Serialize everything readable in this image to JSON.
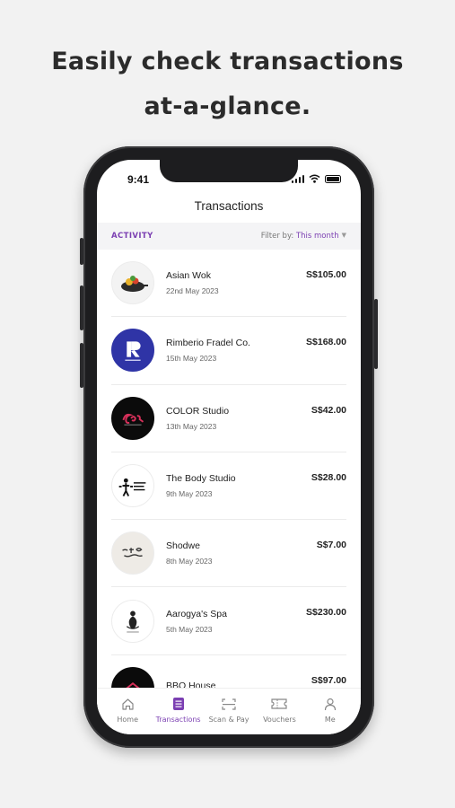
{
  "headline": {
    "line1": "Easily check transactions",
    "line2": "at-a-glance."
  },
  "status_bar": {
    "time": "9:41"
  },
  "header": {
    "title": "Transactions"
  },
  "filter_bar": {
    "activity_label": "ACTIVITY",
    "filter_prefix": "Filter by:",
    "filter_value": "This month"
  },
  "transactions": [
    {
      "name": "Asian Wok",
      "date": "22nd May 2023",
      "amount": "S$105.00",
      "logo": "asian-wok-logo"
    },
    {
      "name": "Rimberio Fradel Co.",
      "date": "15th May 2023",
      "amount": "S$168.00",
      "logo": "rimberio-logo"
    },
    {
      "name": "COLOR Studio",
      "date": "13th May 2023",
      "amount": "S$42.00",
      "logo": "color-studio-logo"
    },
    {
      "name": "The Body Studio",
      "date": "9th May 2023",
      "amount": "S$28.00",
      "logo": "body-studio-logo"
    },
    {
      "name": "Shodwe",
      "date": "8th May 2023",
      "amount": "S$7.00",
      "logo": "shodwe-logo"
    },
    {
      "name": "Aarogya's Spa",
      "date": "5th May 2023",
      "amount": "S$230.00",
      "logo": "aarogya-spa-logo"
    },
    {
      "name": "BBO House",
      "date": "",
      "amount": "S$97.00",
      "logo": "bbo-house-logo"
    }
  ],
  "tabs": [
    {
      "label": "Home",
      "icon": "home-icon",
      "active": false
    },
    {
      "label": "Transactions",
      "icon": "transactions-icon",
      "active": true
    },
    {
      "label": "Scan & Pay",
      "icon": "scan-icon",
      "active": false
    },
    {
      "label": "Vouchers",
      "icon": "voucher-icon",
      "active": false
    },
    {
      "label": "Me",
      "icon": "profile-icon",
      "active": false
    }
  ],
  "colors": {
    "accent": "#7b3fb2",
    "background": "#f2f2f2",
    "phone_frame": "#1d1d1f"
  }
}
